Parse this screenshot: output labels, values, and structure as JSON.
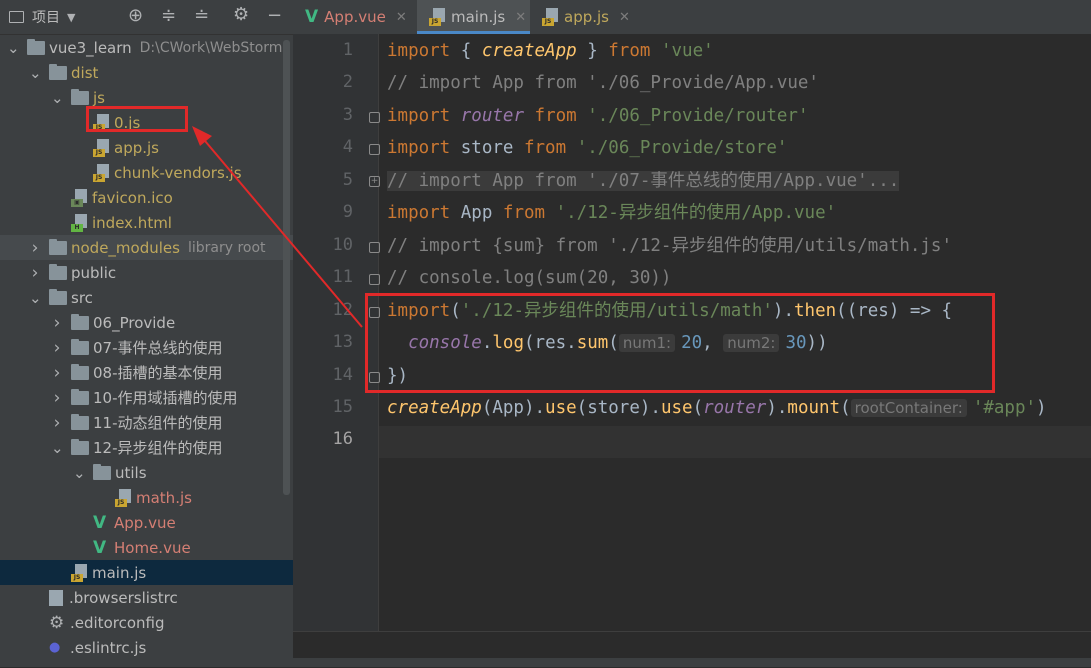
{
  "project_panel": {
    "title": "项目",
    "toolbar": [
      "target-icon",
      "expand-all-icon",
      "collapse-all-icon",
      "settings-icon",
      "hide-icon"
    ]
  },
  "tree": [
    {
      "label": "vue3_learn",
      "extra": "D:\\CWork\\WebStorm",
      "type": "folder",
      "depth": 0,
      "expanded": true,
      "color": "#bbbbbb"
    },
    {
      "label": "dist",
      "type": "folder",
      "depth": 1,
      "expanded": true,
      "color": "#bfa85c"
    },
    {
      "label": "js",
      "type": "folder",
      "depth": 2,
      "expanded": true,
      "color": "#bfa85c"
    },
    {
      "label": "0.js",
      "type": "js",
      "depth": 3,
      "color": "#bfa85c",
      "boxed": true
    },
    {
      "label": "app.js",
      "type": "js",
      "depth": 3,
      "color": "#bfa85c"
    },
    {
      "label": "chunk-vendors.js",
      "type": "js",
      "depth": 3,
      "color": "#bfa85c"
    },
    {
      "label": "favicon.ico",
      "type": "ico",
      "depth": 2,
      "color": "#bfa85c"
    },
    {
      "label": "index.html",
      "type": "html",
      "depth": 2,
      "color": "#bfa85c"
    },
    {
      "label": "node_modules",
      "extra": "library root",
      "type": "folder",
      "depth": 1,
      "expanded": false,
      "color": "#bfa85c",
      "lib": true
    },
    {
      "label": "public",
      "type": "folder",
      "depth": 1,
      "expanded": false,
      "color": "#bbbbbb"
    },
    {
      "label": "src",
      "type": "folder",
      "depth": 1,
      "expanded": true,
      "color": "#bbbbbb"
    },
    {
      "label": "06_Provide",
      "type": "folder",
      "depth": 2,
      "expanded": false,
      "color": "#bbbbbb"
    },
    {
      "label": "07-事件总线的使用",
      "type": "folder",
      "depth": 2,
      "expanded": false,
      "color": "#bbbbbb"
    },
    {
      "label": "08-插槽的基本使用",
      "type": "folder",
      "depth": 2,
      "expanded": false,
      "color": "#bbbbbb"
    },
    {
      "label": "10-作用域插槽的使用",
      "type": "folder",
      "depth": 2,
      "expanded": false,
      "color": "#bbbbbb"
    },
    {
      "label": "11-动态组件的使用",
      "type": "folder",
      "depth": 2,
      "expanded": false,
      "color": "#bbbbbb"
    },
    {
      "label": "12-异步组件的使用",
      "type": "folder",
      "depth": 2,
      "expanded": true,
      "color": "#bbbbbb"
    },
    {
      "label": "utils",
      "type": "folder",
      "depth": 3,
      "expanded": true,
      "color": "#bbbbbb"
    },
    {
      "label": "math.js",
      "type": "js",
      "depth": 4,
      "color": "#d57f74"
    },
    {
      "label": "App.vue",
      "type": "vue",
      "depth": 3,
      "color": "#d57f74"
    },
    {
      "label": "Home.vue",
      "type": "vue",
      "depth": 3,
      "color": "#d57f74"
    },
    {
      "label": "main.js",
      "type": "js",
      "depth": 2,
      "color": "#bbbbbb",
      "selected": true
    },
    {
      "label": ".browserslistrc",
      "type": "file",
      "depth": 1,
      "color": "#bbbbbb"
    },
    {
      "label": ".editorconfig",
      "type": "gear",
      "depth": 1,
      "color": "#bbbbbb"
    },
    {
      "label": ".eslintrc.js",
      "type": "eslint",
      "depth": 1,
      "color": "#bbbbbb"
    }
  ],
  "tabs": [
    {
      "label": "App.vue",
      "icon": "vue-icon",
      "color": "#d57f74",
      "active": false
    },
    {
      "label": "main.js",
      "icon": "js-file-icon",
      "color": "#bbbbbb",
      "active": true
    },
    {
      "label": "app.js",
      "icon": "js-file-icon",
      "color": "#bfa85c",
      "active": false
    }
  ],
  "line_numbers": [
    "1",
    "2",
    "3",
    "4",
    "5",
    "9",
    "10",
    "11",
    "12",
    "13",
    "14",
    "15",
    "16"
  ],
  "code": {
    "l1": {
      "a": "import",
      "b": " { ",
      "c": "createApp",
      "d": " } ",
      "e": "from",
      "f": " ",
      "g": "'vue'"
    },
    "l2": "// import App from './06_Provide/App.vue'",
    "l3": {
      "a": "import",
      "b": " ",
      "c": "router",
      "d": " ",
      "e": "from",
      "f": " ",
      "g": "'./06_Provide/router'"
    },
    "l4": {
      "a": "import",
      "b": " store ",
      "e": "from",
      "f": " ",
      "g": "'./06_Provide/store'"
    },
    "l5": "// import App from './07-事件总线的使用/App.vue'...",
    "l6": {
      "a": "import",
      "b": " App ",
      "e": "from",
      "f": " ",
      "g": "'./12-异步组件的使用/App.vue'"
    },
    "l7": "// import {sum} from './12-异步组件的使用/utils/math.js'",
    "l8": "// console.log(sum(20, 30))",
    "l9": {
      "a": "import",
      "b": "(",
      "g": "'./12-异步组件的使用/utils/math'",
      "c": ").",
      "d": "then",
      "e": "((res) => {"
    },
    "l10": {
      "a": "console",
      "b": ".",
      "c": "log",
      "d": "(res.",
      "e": "sum",
      "f": "(",
      "hint1": "num1:",
      "n1": "20",
      "sep": ", ",
      "hint2": "num2:",
      "n2": "30",
      "end": "))"
    },
    "l11": "})",
    "l12": {
      "a": "createApp",
      "b": "(App).",
      "c": "use",
      "d": "(store).",
      "e": "use",
      "f": "(",
      "g": "router",
      "h": ").",
      "i": "mount",
      "j": "(",
      "hint": "rootContainer:",
      "k": "'#app'",
      "l": ")"
    }
  }
}
